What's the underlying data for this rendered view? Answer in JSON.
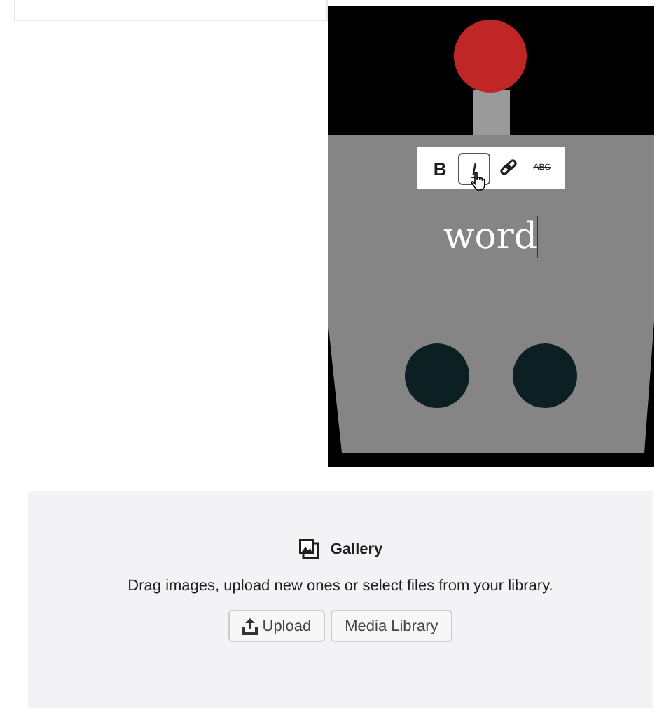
{
  "cover": {
    "kind": "picture",
    "text": "word",
    "toolbar": [
      {
        "kind": "bold",
        "label": "B",
        "selected": false
      },
      {
        "kind": "italic",
        "label": "I",
        "selected": true
      },
      {
        "kind": "link",
        "selected": false
      },
      {
        "kind": "strikethrough",
        "label": "ABC",
        "selected": false
      }
    ]
  },
  "gallery": {
    "title": "Gallery",
    "instructions": "Drag images, upload new ones or select files from your library.",
    "buttons": [
      {
        "kind": "upload",
        "label": "Upload"
      },
      {
        "kind": "plain",
        "label": "Media Library"
      }
    ]
  }
}
